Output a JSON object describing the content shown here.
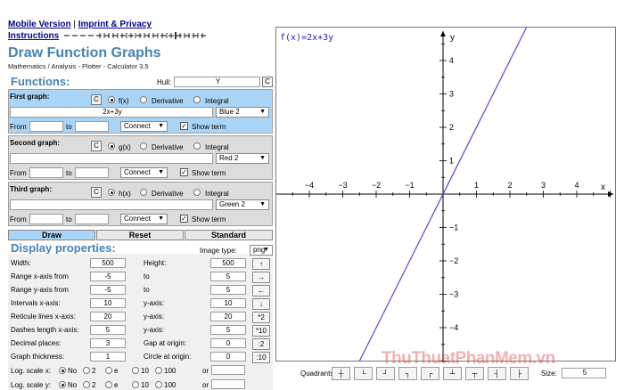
{
  "header": {
    "link_mobile": "Mobile Version",
    "separator": "|",
    "link_imprint": "Imprint & Privacy",
    "link_instructions": "Instructions",
    "title": "Draw Function Graphs",
    "subtitle": "Mathematics / Analysis - Plotter - Calculator 3.5"
  },
  "functions": {
    "heading": "Functions:",
    "hull_label": "Hull:",
    "hull_value": "Y",
    "c_label": "C",
    "graphs": [
      {
        "label": "First graph:",
        "fn_label": "f(x)",
        "term": "2x+3y",
        "color": "Blue 2"
      },
      {
        "label": "Second graph:",
        "fn_label": "g(x)",
        "term": "",
        "color": "Red 2"
      },
      {
        "label": "Third graph:",
        "fn_label": "h(x)",
        "term": "",
        "color": "Green 2"
      }
    ],
    "derivative": "Derivative",
    "integral": "Integral",
    "from": "From",
    "to": "to",
    "connect": "Connect",
    "show_term": "Show term"
  },
  "actions": {
    "draw": "Draw",
    "reset": "Reset",
    "standard": "Standard"
  },
  "display": {
    "heading": "Display properties:",
    "image_type_label": "Image type:",
    "image_type": "png",
    "rows": [
      {
        "l1": "Width:",
        "v1": "500",
        "l2": "Height:",
        "v2": "500"
      },
      {
        "l1": "Range x-axis from",
        "v1": "-5",
        "l2": "to",
        "v2": "5"
      },
      {
        "l1": "Range y-axis from",
        "v1": "-5",
        "l2": "to",
        "v2": "5"
      },
      {
        "l1": "Intervals x-axis:",
        "v1": "10",
        "l2": "y-axis:",
        "v2": "10"
      },
      {
        "l1": "Reticule lines x-axis:",
        "v1": "20",
        "l2": "y-axis:",
        "v2": "20"
      },
      {
        "l1": "Dashes length x-axis:",
        "v1": "5",
        "l2": "y-axis:",
        "v2": "5"
      },
      {
        "l1": "Decimal places:",
        "v1": "3",
        "l2": "Gap at origin:",
        "v2": "0"
      },
      {
        "l1": "Graph thickness:",
        "v1": "1",
        "l2": "Circle at origin:",
        "v2": "0"
      }
    ],
    "log_x_label": "Log. scale x:",
    "log_y_label": "Log. scale y:",
    "log_options": [
      "No",
      "2",
      "e",
      "10",
      "100"
    ],
    "or": "or",
    "side_buttons": [
      "↑",
      "→",
      "←",
      "↓",
      "*2",
      "*10",
      ":2",
      ":10"
    ]
  },
  "graph": {
    "label": "f(x)=2x+3y",
    "axis_x": "x",
    "axis_y": "y",
    "quadrants_label": "Quadrants:",
    "size_label": "Size:",
    "size_value": "5",
    "line_color": "#4a4adf"
  },
  "chart_data": {
    "type": "line",
    "series": [
      {
        "name": "f(x)=2x+3y",
        "x": [
          -2.5,
          2.5
        ],
        "y": [
          -5,
          5
        ]
      }
    ],
    "xlim": [
      -5,
      5
    ],
    "ylim": [
      -5,
      5
    ],
    "x_ticks": [
      -4,
      -3,
      -2,
      -1,
      1,
      2,
      3,
      4
    ],
    "y_ticks": [
      -4,
      -3,
      -2,
      -1,
      1,
      2,
      3,
      4
    ],
    "xlabel": "x",
    "ylabel": "y",
    "grid": true
  },
  "watermark": "ThuThuatPhanMem.vn"
}
